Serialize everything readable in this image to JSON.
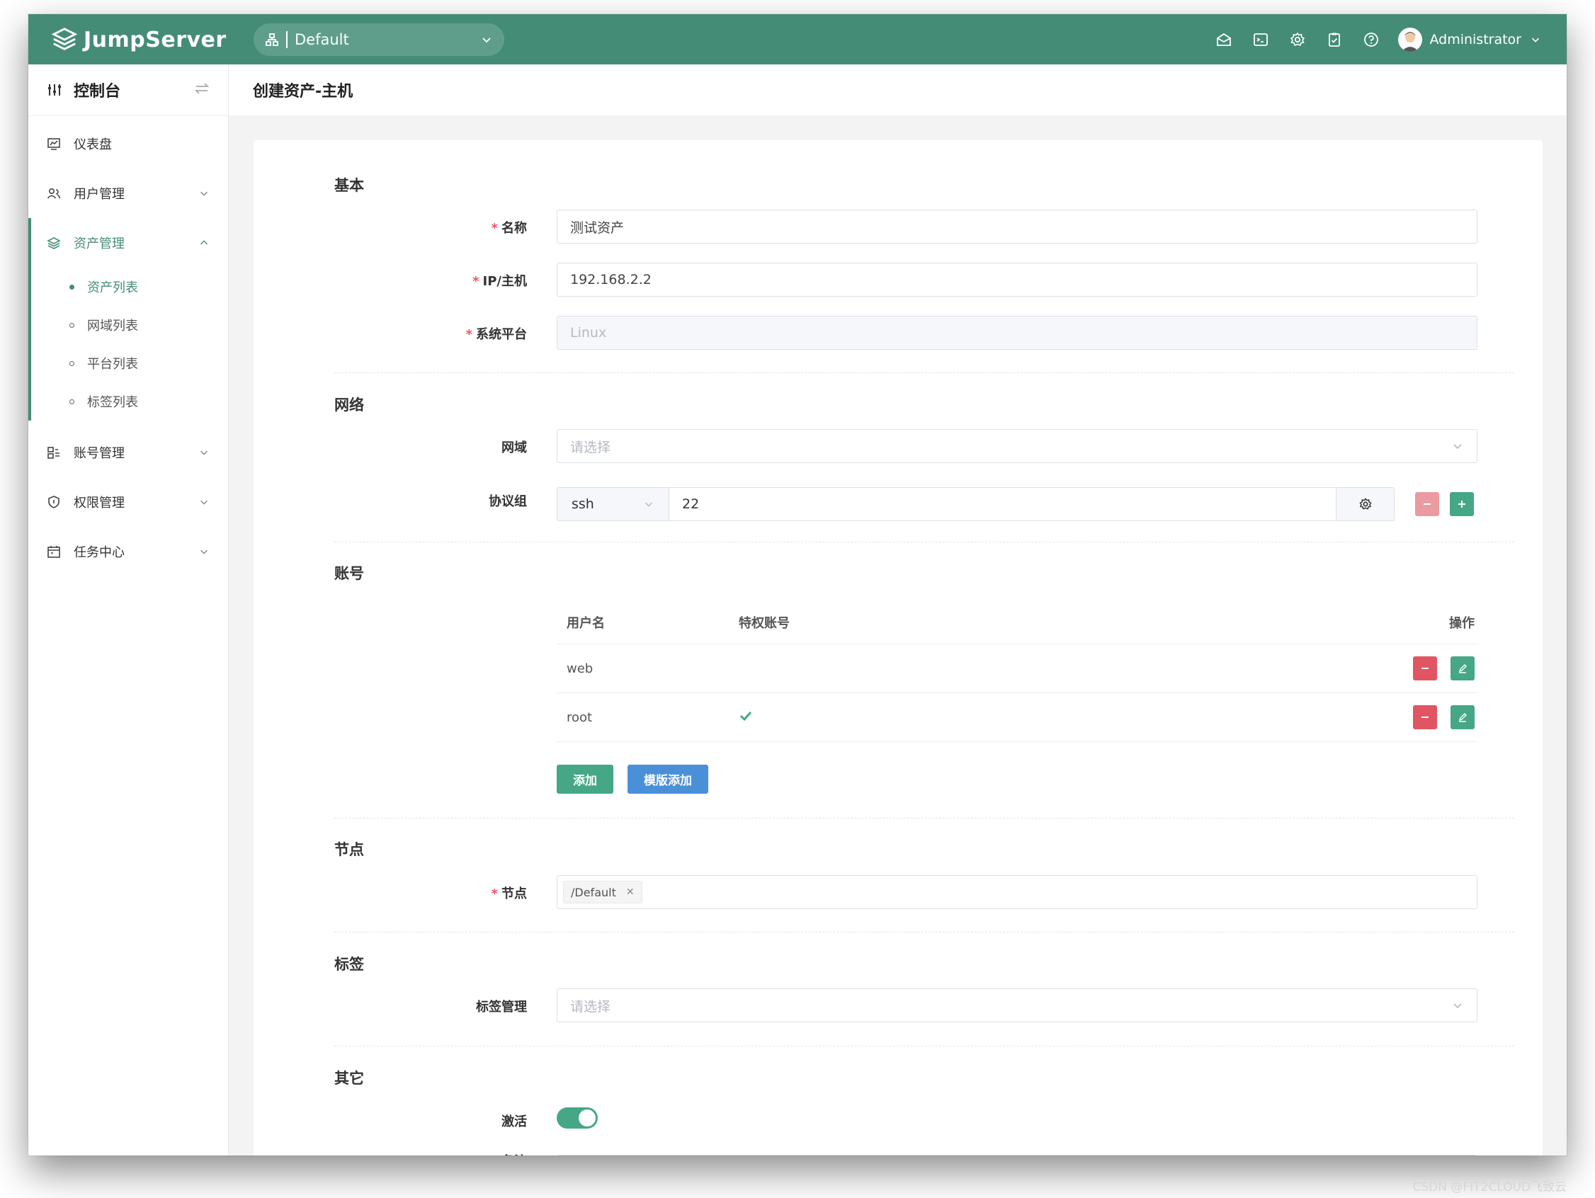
{
  "app": {
    "brand": "JumpServer"
  },
  "topbar": {
    "org_value": "Default",
    "icons": [
      "inbox-icon",
      "terminal-icon",
      "settings-icon",
      "tickets-icon",
      "help-icon"
    ],
    "username": "Administrator"
  },
  "sidebar": {
    "title": "控制台",
    "items": [
      {
        "label": "仪表盘"
      },
      {
        "label": "用户管理"
      },
      {
        "label": "资产管理"
      },
      {
        "label": "账号管理"
      },
      {
        "label": "权限管理"
      },
      {
        "label": "任务中心"
      }
    ],
    "asset_submenu": [
      {
        "label": "资产列表",
        "active": true
      },
      {
        "label": "网域列表"
      },
      {
        "label": "平台列表"
      },
      {
        "label": "标签列表"
      }
    ]
  },
  "page": {
    "title": "创建资产-主机"
  },
  "form": {
    "sections": {
      "basic": "基本",
      "network": "网络",
      "account": "账号",
      "node": "节点",
      "tags": "标签",
      "other": "其它"
    },
    "name": {
      "label": "名称",
      "value": "测试资产"
    },
    "address": {
      "label": "IP/主机",
      "value": "192.168.2.2"
    },
    "platform": {
      "label": "系统平台",
      "value": "Linux"
    },
    "domain": {
      "label": "网域",
      "placeholder": "请选择"
    },
    "protocols": {
      "label": "协议组",
      "protocol": "ssh",
      "port": "22"
    },
    "accounts": {
      "headers": {
        "username": "用户名",
        "privileged": "特权账号",
        "actions": "操作"
      },
      "rows": [
        {
          "username": "web",
          "privileged": false
        },
        {
          "username": "root",
          "privileged": true
        }
      ],
      "add_label": "添加",
      "template_add_label": "模版添加"
    },
    "nodes": {
      "label": "节点",
      "value": "/Default"
    },
    "labels": {
      "label": "标签管理",
      "placeholder": "请选择"
    },
    "is_active": {
      "label": "激活",
      "value": true
    },
    "comment_label": "备注"
  },
  "colors": {
    "brand": "#458c77",
    "danger": "#e05561",
    "success": "#45a785",
    "info": "#4a90d9"
  },
  "watermark": "CSDN @FIT2CLOUD飞致云"
}
